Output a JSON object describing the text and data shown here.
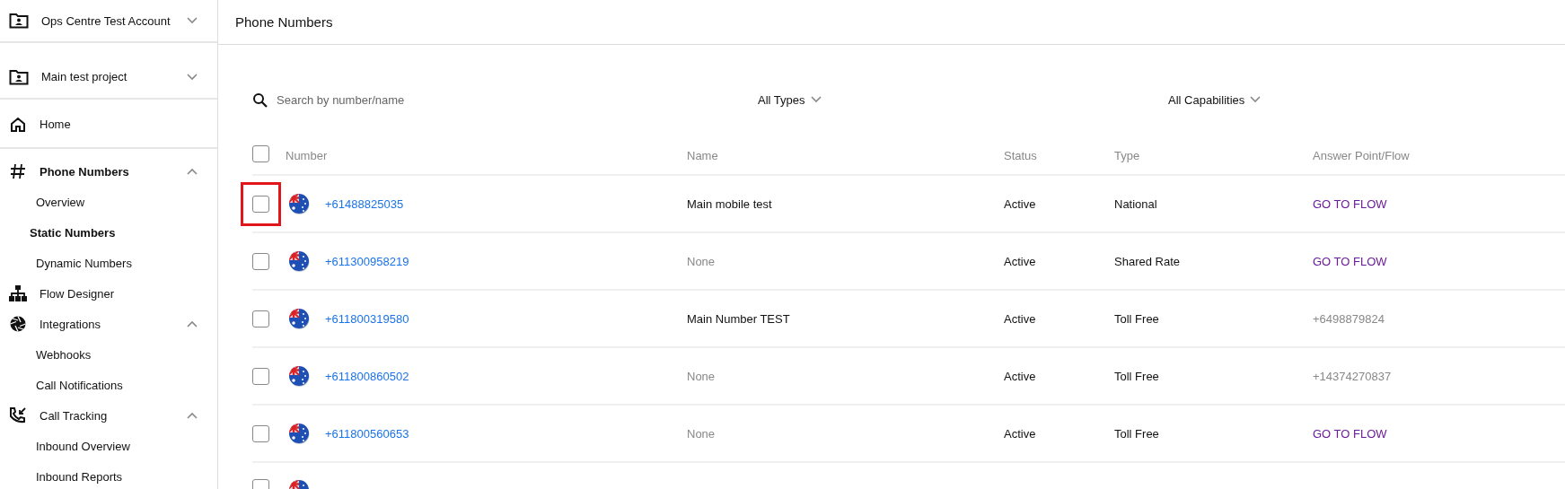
{
  "sidebar": {
    "switchers": [
      {
        "label": "Ops Centre Test Account",
        "expanded": false
      },
      {
        "label": "Main test project",
        "expanded": false
      }
    ],
    "nav": [
      {
        "label": "Home",
        "active": false
      },
      {
        "label": "Phone Numbers",
        "active": true,
        "expanded": true,
        "children": [
          {
            "label": "Overview",
            "selected": false,
            "highlighted": false
          },
          {
            "label": "Static Numbers",
            "selected": true,
            "highlighted": true
          },
          {
            "label": "Dynamic Numbers",
            "selected": false,
            "highlighted": false
          }
        ]
      },
      {
        "label": "Flow Designer",
        "active": false
      },
      {
        "label": "Integrations",
        "active": false,
        "expanded": true,
        "children": [
          {
            "label": "Webhooks",
            "selected": false,
            "highlighted": false
          },
          {
            "label": "Call Notifications",
            "selected": false,
            "highlighted": false
          }
        ]
      },
      {
        "label": "Call Tracking",
        "active": false,
        "expanded": true,
        "children": [
          {
            "label": "Inbound Overview",
            "selected": false,
            "highlighted": false
          },
          {
            "label": "Inbound Reports",
            "selected": false,
            "highlighted": false
          }
        ]
      }
    ]
  },
  "header": {
    "title": "Phone Numbers"
  },
  "filters": {
    "search": {
      "placeholder": "Search by number/name"
    },
    "type_select": "All Types",
    "capability_select": "All Capabilities"
  },
  "table": {
    "select_all": {
      "checked": false
    },
    "columns": [
      "Number",
      "Name",
      "Status",
      "Type",
      "Answer Point/Flow"
    ],
    "rows": [
      {
        "checked": false,
        "highlighted": true,
        "number": "+61488825035",
        "name": "Main mobile test",
        "name_set": true,
        "status": "Active",
        "type": "National",
        "answer": "GO TO FLOW",
        "answer_link": true
      },
      {
        "checked": false,
        "highlighted": false,
        "number": "+611300958219",
        "name": "None",
        "name_set": false,
        "status": "Active",
        "type": "Shared Rate",
        "answer": "GO TO FLOW",
        "answer_link": true
      },
      {
        "checked": false,
        "highlighted": false,
        "number": "+611800319580",
        "name": "Main Number TEST",
        "name_set": true,
        "status": "Active",
        "type": "Toll Free",
        "answer": "+6498879824",
        "answer_link": false
      },
      {
        "checked": false,
        "highlighted": false,
        "number": "+611800860502",
        "name": "None",
        "name_set": false,
        "status": "Active",
        "type": "Toll Free",
        "answer": "+14374270837",
        "answer_link": false
      },
      {
        "checked": false,
        "highlighted": false,
        "number": "+611800560653",
        "name": "None",
        "name_set": false,
        "status": "Active",
        "type": "Toll Free",
        "answer": "GO TO FLOW",
        "answer_link": true
      }
    ],
    "partial_row": {
      "checked": false
    }
  }
}
